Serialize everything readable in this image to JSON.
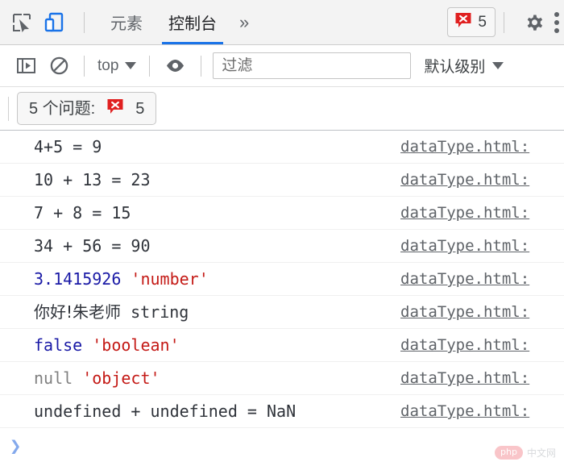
{
  "tabbar": {
    "inspect_icon": "inspect-element-icon",
    "device_icon": "device-toolbar-icon",
    "tabs": [
      {
        "label": "元素",
        "active": false
      },
      {
        "label": "控制台",
        "active": true
      }
    ],
    "more_tabs_label": "»",
    "error_badge": {
      "icon": "error-bubble-icon",
      "count": "5"
    },
    "settings_icon": "gear-icon",
    "menu_icon": "kebab-menu-icon",
    "active_accent_color": "#1a73e8",
    "error_color": "#e02020"
  },
  "console_toolbar": {
    "sidebar_toggle_icon": "console-sidebar-icon",
    "clear_icon": "clear-console-icon",
    "context_label": "top",
    "eye_icon": "live-expression-icon",
    "filter": {
      "placeholder": "过滤",
      "value": ""
    },
    "level_label": "默认级别"
  },
  "issues_bar": {
    "label": "5 个问题:",
    "icon": "error-bubble-icon",
    "count": "5"
  },
  "console_log": {
    "source_link": "dataType.html:",
    "rows": [
      {
        "tokens": [
          {
            "text": "4+5 = 9",
            "type": "plain"
          }
        ]
      },
      {
        "tokens": [
          {
            "text": "10 + 13 = 23",
            "type": "plain"
          }
        ]
      },
      {
        "tokens": [
          {
            "text": "7 + 8 = 15",
            "type": "plain"
          }
        ]
      },
      {
        "tokens": [
          {
            "text": "34 + 56 = 90",
            "type": "plain"
          }
        ]
      },
      {
        "tokens": [
          {
            "text": "3.1415926",
            "type": "num"
          },
          {
            "text": " ",
            "type": "plain"
          },
          {
            "text": "'number'",
            "type": "str"
          }
        ]
      },
      {
        "tokens": [
          {
            "text": "你好!朱老师",
            "type": "cjk"
          },
          {
            "text": " string",
            "type": "plain"
          }
        ]
      },
      {
        "tokens": [
          {
            "text": "false",
            "type": "num"
          },
          {
            "text": " ",
            "type": "plain"
          },
          {
            "text": "'boolean'",
            "type": "str"
          }
        ]
      },
      {
        "tokens": [
          {
            "text": "null",
            "type": "null"
          },
          {
            "text": " ",
            "type": "plain"
          },
          {
            "text": "'object'",
            "type": "str"
          }
        ]
      },
      {
        "tokens": [
          {
            "text": "undefined + undefined = NaN",
            "type": "plain"
          }
        ]
      }
    ]
  },
  "prompt": {
    "chevron": "›",
    "value": ""
  },
  "watermark": {
    "badge": "php",
    "text": "中文网"
  }
}
